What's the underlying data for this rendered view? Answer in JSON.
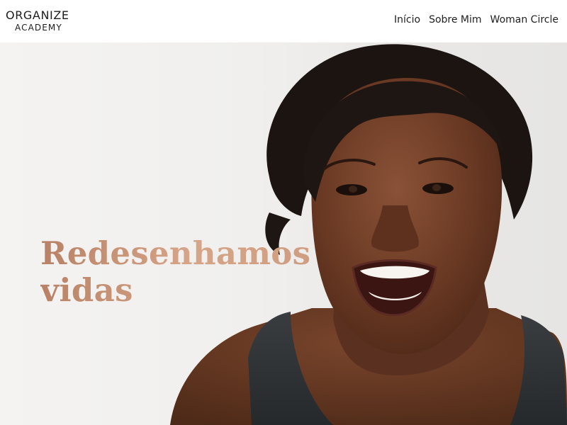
{
  "brand": {
    "line1": "ORGANIZE",
    "line2": "ACADEMY"
  },
  "nav": {
    "items": [
      {
        "label": "Início"
      },
      {
        "label": "Sobre Mim"
      },
      {
        "label": "Woman Circle"
      }
    ]
  },
  "hero": {
    "headline_line1": "Redesenhamos",
    "headline_line2": "vidas",
    "headline_color": "#c9977b",
    "image": "portrait of a smiling woman with short dark hair wearing a dark tank top"
  },
  "colors": {
    "background": "#ffffff",
    "hero_background": "#eeedeb",
    "text": "#1f1f1f",
    "accent": "#c9977b"
  }
}
